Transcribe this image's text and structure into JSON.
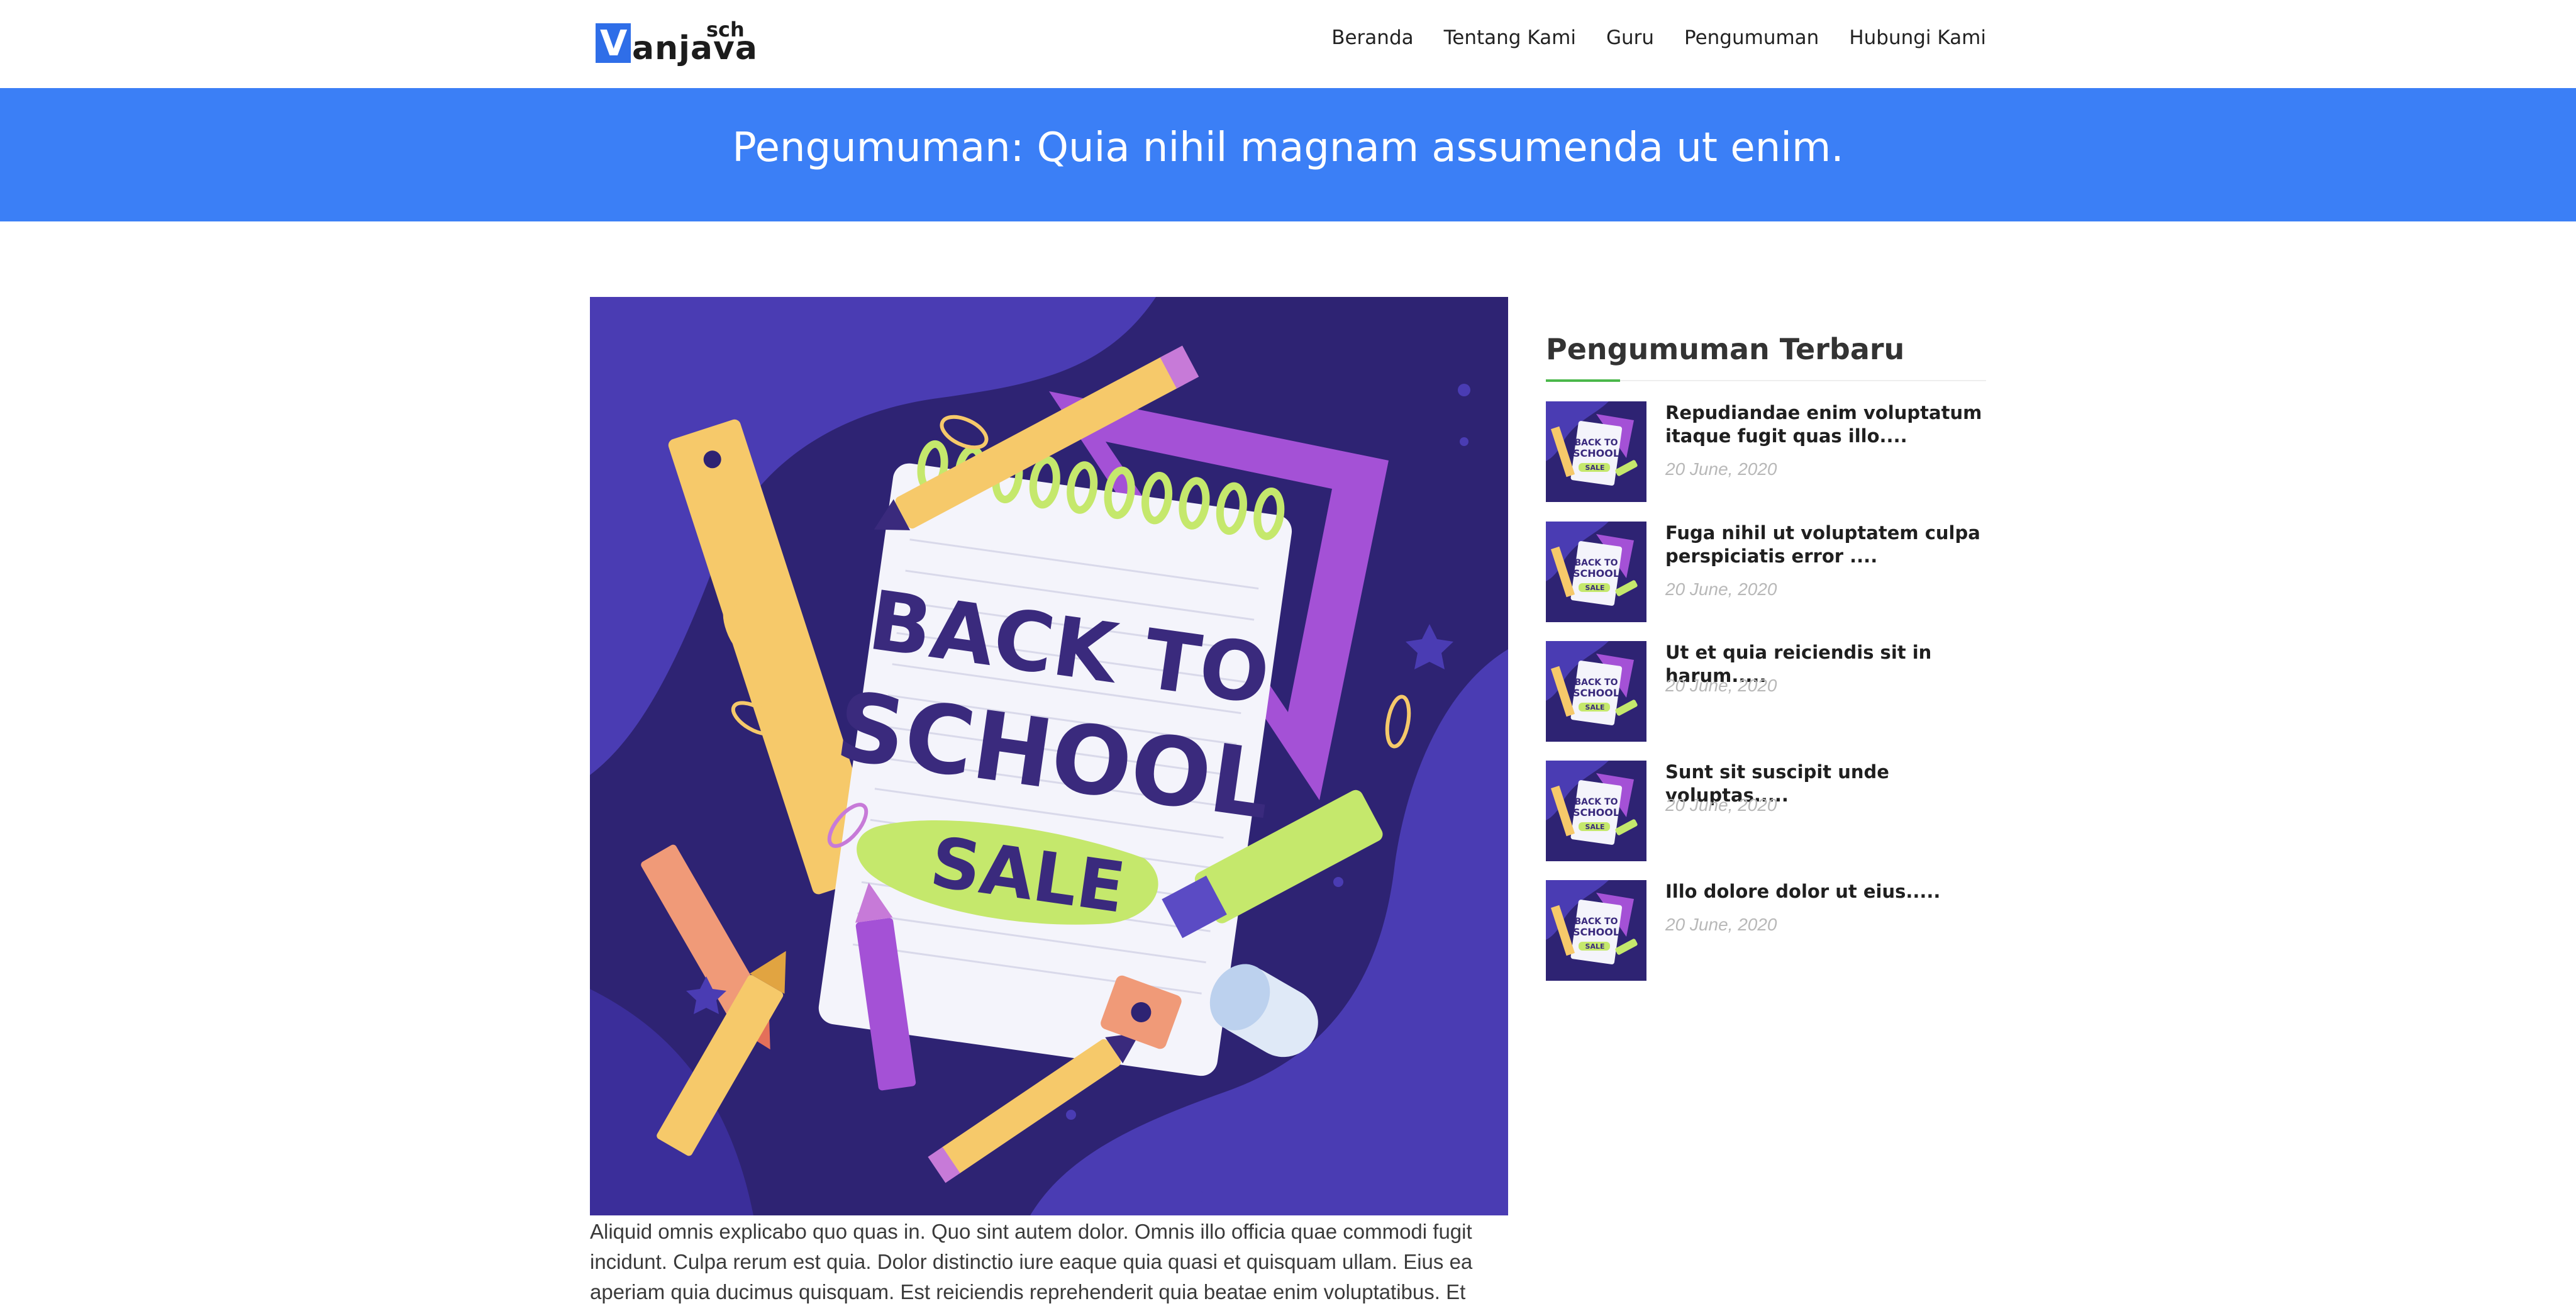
{
  "header": {
    "logo": {
      "mark": "V",
      "rest": "anjava",
      "sup": "sch"
    },
    "nav": [
      {
        "label": "Beranda"
      },
      {
        "label": "Tentang Kami"
      },
      {
        "label": "Guru"
      },
      {
        "label": "Pengumuman"
      },
      {
        "label": "Hubungi Kami"
      }
    ]
  },
  "banner": {
    "title": "Pengumuman: Quia nihil magnam assumenda ut enim."
  },
  "article": {
    "image": {
      "line1": "BACK TO",
      "line2": "SCHOOL",
      "line3": "SALE"
    },
    "body": "Aliquid omnis explicabo quo quas in. Quo sint autem dolor. Omnis illo officia quae commodi fugit incidunt. Culpa rerum est quia. Dolor distinctio iure eaque quia quasi et quisquam ullam. Eius ea aperiam quia ducimus quisquam. Est reiciendis reprehenderit quia beatae enim voluptatibus. Et"
  },
  "sidebar": {
    "title": "Pengumuman Terbaru",
    "items": [
      {
        "title": "Repudiandae enim voluptatum itaque fugit quas illo....",
        "date": "20 June, 2020"
      },
      {
        "title": "Fuga nihil ut voluptatem culpa perspiciatis error ....",
        "date": "20 June, 2020"
      },
      {
        "title": "Ut et quia reiciendis sit in harum.....",
        "date": "20 June, 2020"
      },
      {
        "title": "Sunt sit suscipit unde voluptas.....",
        "date": "20 June, 2020"
      },
      {
        "title": "Illo dolore dolor ut eius.....",
        "date": "20 June, 2020"
      }
    ]
  },
  "colors": {
    "banner": "#3b7ff6",
    "logo_box": "#2f6ee8",
    "accent_rule": "#4bb84b",
    "illustration_bg": "#2e2373"
  }
}
